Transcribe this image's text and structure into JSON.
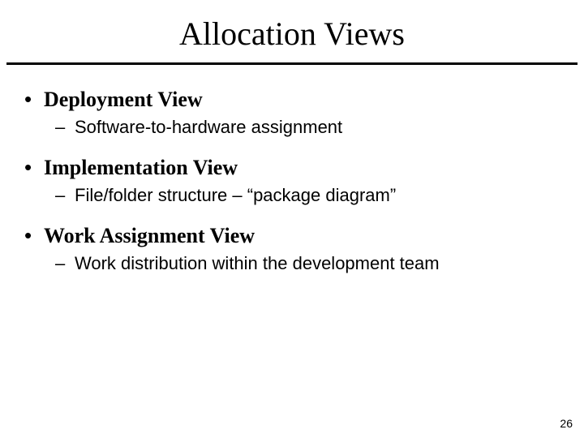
{
  "title": "Allocation Views",
  "bullets": [
    {
      "label": "Deployment View",
      "sub": "Software-to-hardware assignment"
    },
    {
      "label": "Implementation View",
      "sub": "File/folder structure – “package diagram”"
    },
    {
      "label": "Work Assignment View",
      "sub": "Work distribution within the development team"
    }
  ],
  "page_number": "26"
}
